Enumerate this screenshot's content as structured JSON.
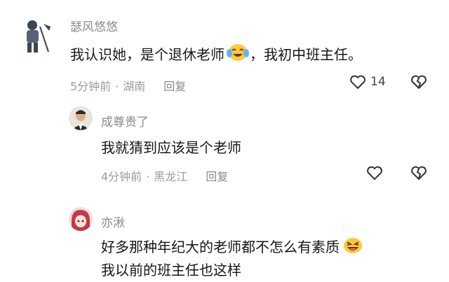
{
  "comments": [
    {
      "username": "瑟风悠悠",
      "text": "我认识她，是个退休老师",
      "text_after": "，我初中班主任。",
      "time": "5分钟前",
      "location": "湖南",
      "reply": "回复",
      "likes": "14"
    },
    {
      "username": "成尊贵了",
      "text": "我就猜到应该是个老师",
      "time": "4分钟前",
      "location": "黑龙江",
      "reply": "回复"
    },
    {
      "username": "亦湫",
      "text_line1": "好多那种年纪大的老师都不怎么有素质",
      "text_line2": "我以前的班主任也这样"
    }
  ]
}
